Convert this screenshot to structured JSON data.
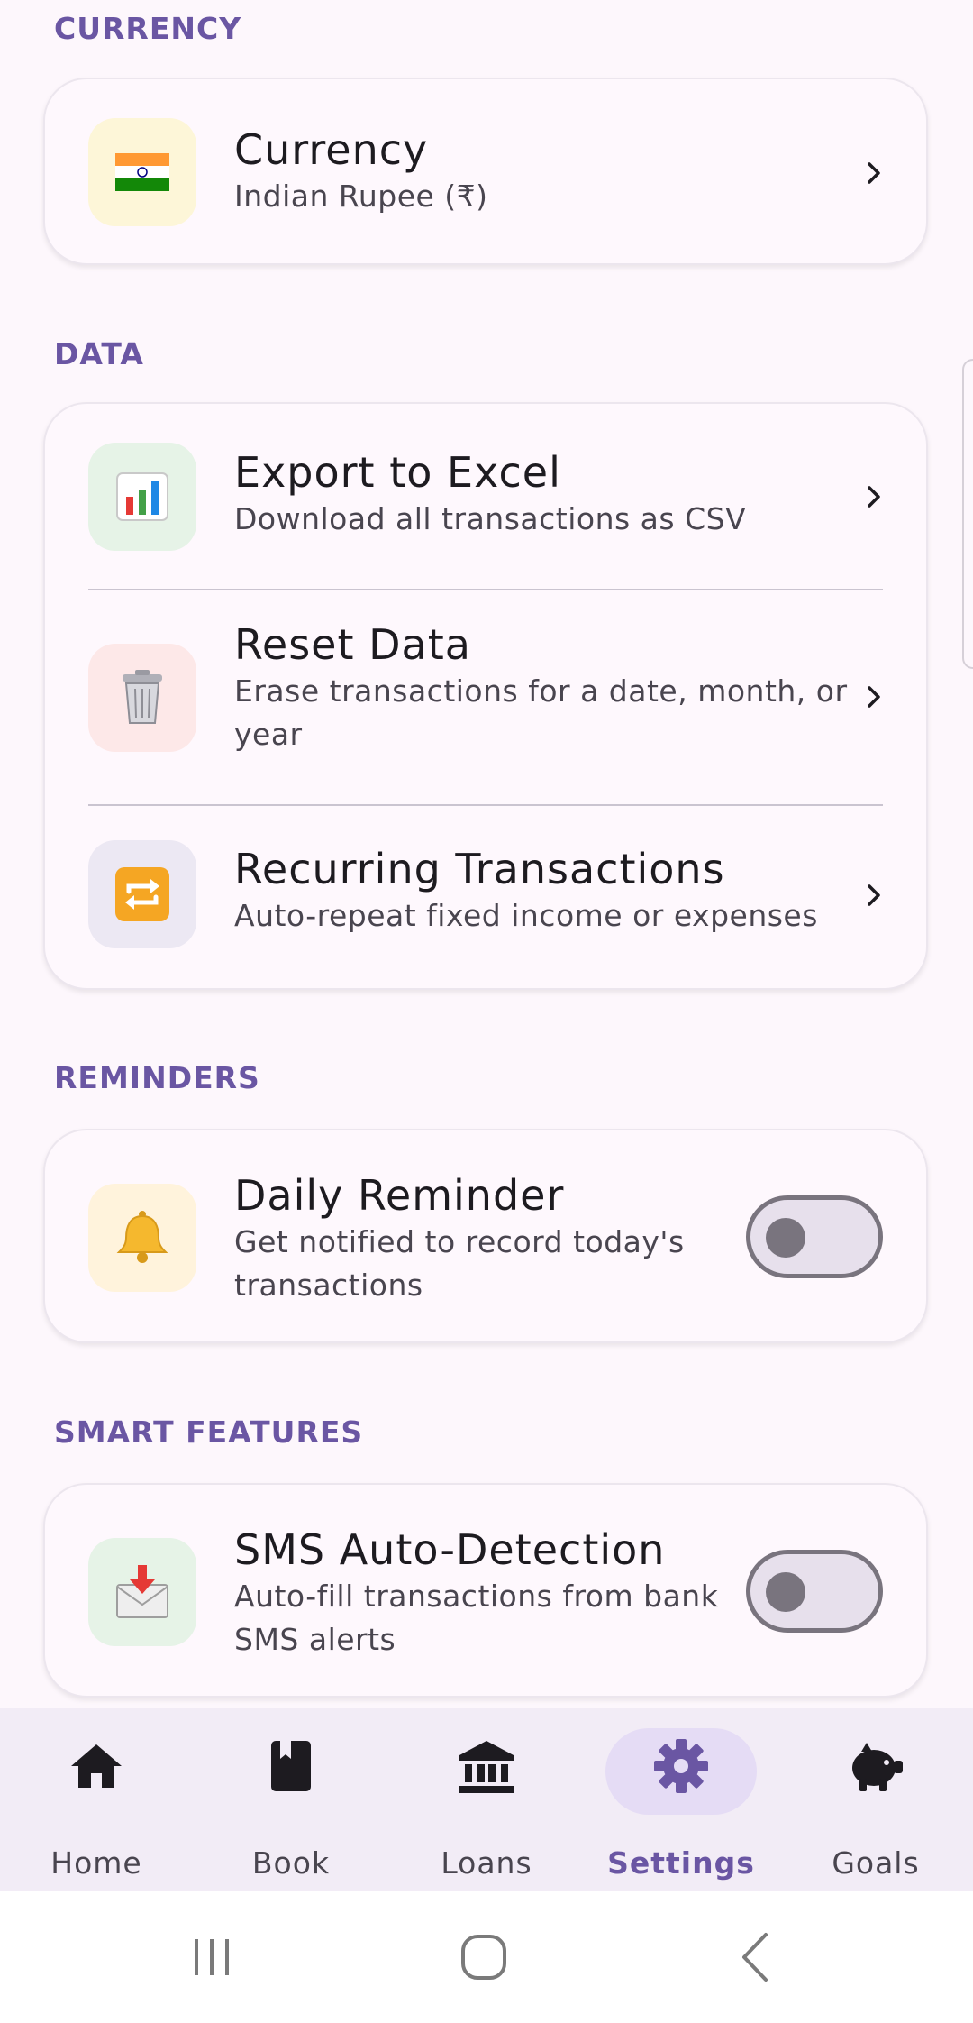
{
  "sections": {
    "currency": {
      "label": "CURRENCY",
      "item": {
        "title": "Currency",
        "subtitle": "Indian Rupee (₹)",
        "icon": "india-flag-icon"
      }
    },
    "data": {
      "label": "DATA",
      "items": [
        {
          "title": "Export to Excel",
          "subtitle": "Download all transactions as CSV",
          "icon": "bar-chart-icon"
        },
        {
          "title": "Reset Data",
          "subtitle_line1": "Erase transactions for a date, month, or",
          "subtitle_line2": "year",
          "icon": "trash-can-icon"
        },
        {
          "title": "Recurring Transactions",
          "subtitle": "Auto-repeat fixed income or expenses",
          "icon": "repeat-icon"
        }
      ]
    },
    "reminders": {
      "label": "REMINDERS",
      "item": {
        "title": "Daily Reminder",
        "subtitle_line1": "Get notified to record today's",
        "subtitle_line2": "transactions",
        "icon": "bell-icon",
        "enabled": false
      }
    },
    "smart_features": {
      "label": "SMART FEATURES",
      "item": {
        "title": "SMS Auto-Detection",
        "subtitle_line1": "Auto-fill transactions from bank",
        "subtitle_line2": "SMS alerts",
        "icon": "inbox-envelope-icon",
        "enabled": false
      }
    }
  },
  "bottom_nav": {
    "items": [
      {
        "label": "Home",
        "icon": "home-icon"
      },
      {
        "label": "Book",
        "icon": "book-icon"
      },
      {
        "label": "Loans",
        "icon": "bank-icon"
      },
      {
        "label": "Settings",
        "icon": "gear-icon",
        "active": true
      },
      {
        "label": "Goals",
        "icon": "piggy-bank-icon"
      }
    ]
  },
  "colors": {
    "accent": "#6a56a3",
    "background": "#fdf7fc",
    "nav_background": "#f2ecf6"
  }
}
